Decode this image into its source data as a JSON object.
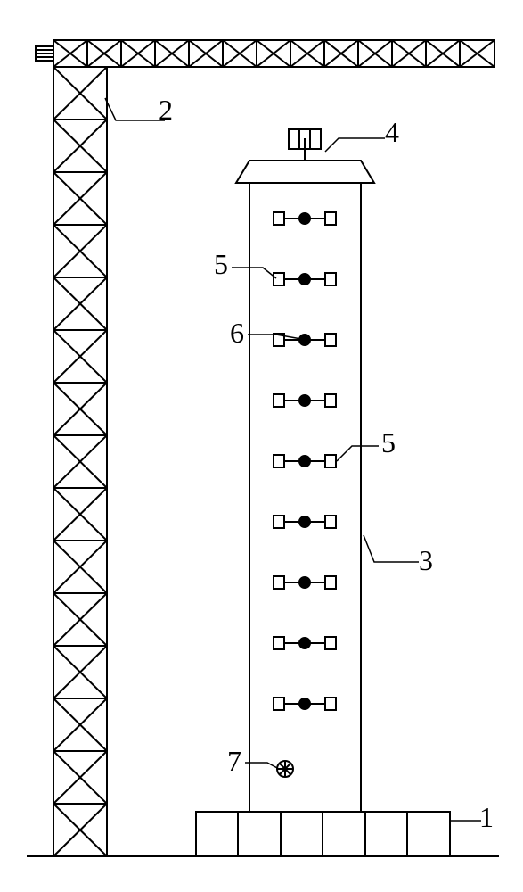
{
  "labels": {
    "base": "1",
    "crane": "2",
    "column": "3",
    "top_device": "4",
    "sensor_left": "5",
    "sensor_right": "5",
    "sensor_mid": "6",
    "bottom_item": "7"
  },
  "diagram": {
    "crane_sections": 15,
    "jib_sections": 13,
    "sensor_rows": 9,
    "base_blocks": 6
  }
}
